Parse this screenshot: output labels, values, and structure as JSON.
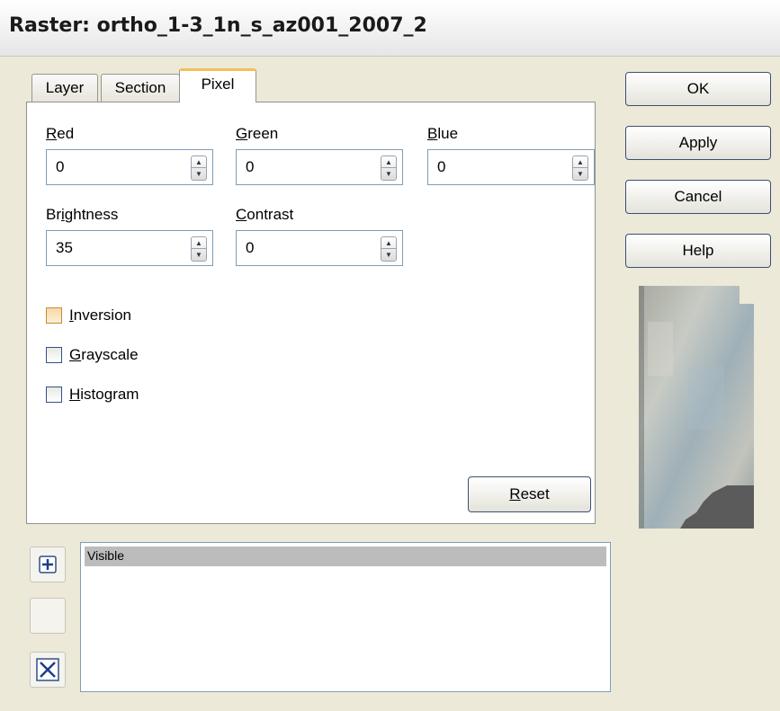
{
  "window": {
    "title": "Raster: ortho_1-3_1n_s_az001_2007_2"
  },
  "tabs": [
    {
      "label": "Layer",
      "active": false
    },
    {
      "label": "Section",
      "active": false
    },
    {
      "label": "Pixel",
      "active": true
    }
  ],
  "fields": {
    "red": {
      "label_first": "R",
      "label_rest": "ed",
      "value": "0"
    },
    "green": {
      "label_first": "G",
      "label_rest": "reen",
      "value": "0"
    },
    "blue": {
      "label_first": "B",
      "label_rest": "lue",
      "value": "0"
    },
    "brightness": {
      "label_pre": "Br",
      "label_ul": "i",
      "label_post": "ghtness",
      "value": "35"
    },
    "contrast": {
      "label_first": "C",
      "label_rest": "ontrast",
      "value": "0"
    }
  },
  "checkboxes": {
    "inversion": {
      "label_first": "I",
      "label_rest": "nversion",
      "checked": false
    },
    "grayscale": {
      "label_first": "G",
      "label_rest": "rayscale",
      "checked": false
    },
    "histogram": {
      "label_first": "H",
      "label_rest": "istogram",
      "checked": false
    }
  },
  "reset": {
    "label_first": "R",
    "label_rest": "eset"
  },
  "buttons": {
    "ok": "OK",
    "apply": "Apply",
    "cancel": "Cancel",
    "help": "Help"
  },
  "list": {
    "header": "Visible",
    "items": []
  },
  "side_buttons": {
    "add_icon": "plus-icon",
    "remove_icon": "x-icon"
  },
  "colors": {
    "tab_highlight": "#f2c15a",
    "list_header": "#bcbcbc",
    "button_border": "#3b4f74"
  }
}
